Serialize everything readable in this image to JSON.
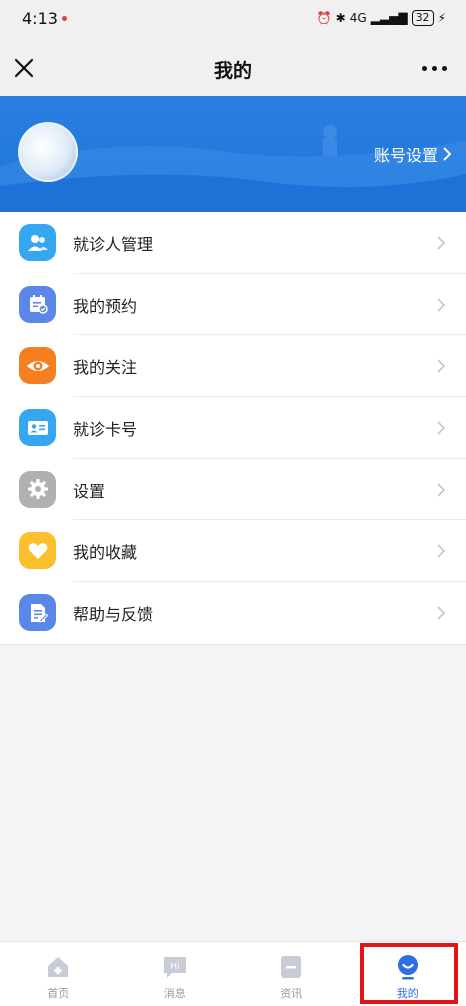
{
  "status_bar": {
    "time": "4:13",
    "signal_label": "4G",
    "battery": "32",
    "colors": {
      "notification_dot": "#e04040"
    }
  },
  "navbar": {
    "title": "我的",
    "close_icon": "close-icon",
    "more_icon": "more-icon"
  },
  "banner": {
    "account_settings_label": "账号设置",
    "colors": {
      "background": "#1f74dc"
    }
  },
  "menu": {
    "items": [
      {
        "label": "就诊人管理",
        "icon": "patients-icon",
        "color": "#35a6f0"
      },
      {
        "label": "我的预约",
        "icon": "calendar-check-icon",
        "color": "#5a87e8"
      },
      {
        "label": "我的关注",
        "icon": "eye-icon",
        "color": "#f47f20"
      },
      {
        "label": "就诊卡号",
        "icon": "id-card-icon",
        "color": "#35a6f0"
      },
      {
        "label": "设置",
        "icon": "gear-icon",
        "color": "#b0b0b0"
      },
      {
        "label": "我的收藏",
        "icon": "heart-icon",
        "color": "#fbc02d"
      },
      {
        "label": "帮助与反馈",
        "icon": "feedback-doc-icon",
        "color": "#5a87e8"
      }
    ]
  },
  "tabbar": {
    "tabs": [
      {
        "label": "首页",
        "icon": "home-icon",
        "active": false
      },
      {
        "label": "消息",
        "icon": "message-icon",
        "active": false
      },
      {
        "label": "资讯",
        "icon": "news-icon",
        "active": false
      },
      {
        "label": "我的",
        "icon": "profile-icon",
        "active": true
      }
    ],
    "colors": {
      "active": "#2d6fe0",
      "inactive": "#9a9a9a",
      "highlight": "#e01515"
    }
  }
}
